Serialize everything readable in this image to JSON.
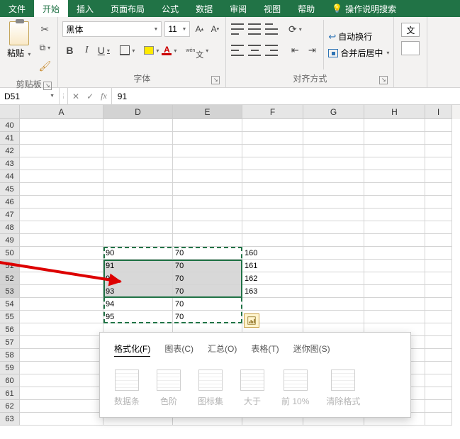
{
  "tabs": {
    "file": "文件",
    "home": "开始",
    "insert": "插入",
    "layout": "页面布局",
    "formula": "公式",
    "data": "数据",
    "review": "审阅",
    "view": "视图",
    "help": "帮助",
    "tellme": "操作说明搜索"
  },
  "ribbon": {
    "paste": "粘贴",
    "clipboard_label": "剪贴板",
    "font_name": "黑体",
    "font_size": "11",
    "font_label": "字体",
    "wrap": "自动换行",
    "merge": "合并后居中",
    "align_label": "对齐方式",
    "style_hint": "文"
  },
  "formula": {
    "name": "D51",
    "fx": "fx",
    "value": "91"
  },
  "columns": [
    "A",
    "D",
    "E",
    "F",
    "G",
    "H",
    "I"
  ],
  "rows": [
    "40",
    "41",
    "42",
    "43",
    "44",
    "45",
    "46",
    "47",
    "48",
    "49",
    "50",
    "51",
    "52",
    "53",
    "54",
    "55",
    "56",
    "57",
    "58",
    "59",
    "60",
    "61",
    "62",
    "63"
  ],
  "cells": {
    "D50": "90",
    "E50": "70",
    "F50": "160",
    "D51": "91",
    "E51": "70",
    "F51": "161",
    "D52": "92",
    "E52": "70",
    "F52": "162",
    "D53": "93",
    "E53": "70",
    "F53": "163",
    "D54": "94",
    "E54": "70",
    "D55": "95",
    "E55": "70"
  },
  "quick": {
    "tabs": {
      "format": "格式化(F)",
      "chart": "图表(C)",
      "total": "汇总(O)",
      "table": "表格(T)",
      "spark": "迷你图(S)"
    },
    "items": {
      "databar": "数据条",
      "colorscale": "色阶",
      "iconset": "图标集",
      "greater": "大于",
      "top10": "前 10%",
      "clear": "清除格式"
    }
  }
}
